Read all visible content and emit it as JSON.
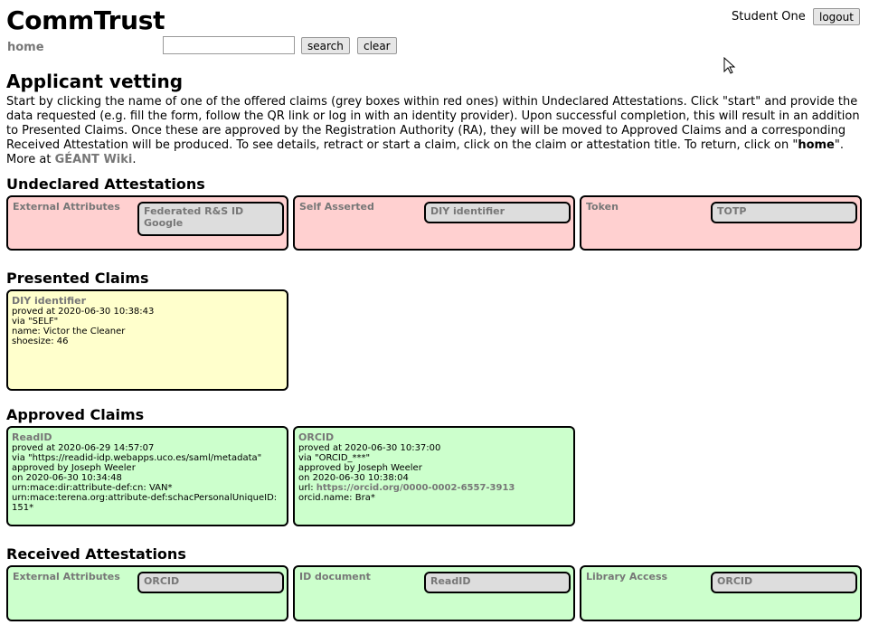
{
  "header": {
    "logo": "CommTrust",
    "home_link": "home",
    "search_value": "",
    "search_button": "search",
    "clear_button": "clear",
    "user_name": "Student One",
    "logout_button": "logout"
  },
  "page": {
    "title": "Applicant vetting",
    "intro_1": "Start by clicking the name of one of the offered claims (grey boxes within red ones) within Undeclared Attestations. Click \"start\" and provide the data requested (e.g. fill the form, follow the QR link or log in with an identity provider). Upon successful completion, this will result in an addition to Presented Claims. Once these are approved by the Registration Authority (RA), they will be moved to Approved Claims and a corresponding Received Attestation will be produced. To see details, retract or start a claim, click on the claim or attestation title. To return, click on \"",
    "intro_home": "home",
    "intro_2": "\". More at ",
    "intro_wiki": "GÉANT Wiki",
    "intro_3": "."
  },
  "undeclared": {
    "heading": "Undeclared Attestations",
    "boxes": [
      {
        "title": "External Attributes",
        "chips": [
          "Federated R&S ID\nGoogle"
        ]
      },
      {
        "title": "Self Asserted",
        "chips": [
          "DIY identifier"
        ]
      },
      {
        "title": "Token",
        "chips": [
          "TOTP"
        ]
      }
    ]
  },
  "presented": {
    "heading": "Presented Claims",
    "claims": [
      {
        "title": "DIY identifier",
        "lines": [
          "proved at 2020-06-30 10:38:43",
          "via \"SELF\"",
          "name: Victor the Cleaner",
          "shoesize: 46"
        ]
      }
    ]
  },
  "approved": {
    "heading": "Approved Claims",
    "claims": [
      {
        "title": "ReadID",
        "lines": [
          "proved at 2020-06-29 14:57:07",
          "via \"https://readid-idp.webapps.uco.es/saml/metadata\"",
          "approved by Joseph Weeler",
          "on 2020-06-30 10:34:48",
          "urn:mace:dir:attribute-def:cn: VAN*",
          "urn:mace:terena.org:attribute-def:schacPersonalUniqueID:",
          "151*"
        ]
      },
      {
        "title": "ORCID",
        "lines": [
          "proved at 2020-06-30 10:37:00",
          "via \"ORCID_***\"",
          "approved by Joseph Weeler",
          "on 2020-06-30 10:38:04"
        ],
        "url_label": "url: ",
        "url": "https://orcid.org/0000-0002-6557-3913",
        "extra": "orcid.name: Bra*"
      }
    ]
  },
  "received": {
    "heading": "Received Attestations",
    "boxes": [
      {
        "title": "External Attributes",
        "chips": [
          "ORCID"
        ]
      },
      {
        "title": "ID document",
        "chips": [
          "ReadID"
        ]
      },
      {
        "title": "Library Access",
        "chips": [
          "ORCID"
        ]
      }
    ]
  },
  "colors": {
    "undeclared_bg": "#ffd0d0",
    "presented_bg": "#ffffcc",
    "approved_bg": "#ccffcc",
    "chip_bg": "#dddddd",
    "label_grey": "#777777"
  },
  "icons": {
    "cursor": "mouse-pointer-icon"
  }
}
